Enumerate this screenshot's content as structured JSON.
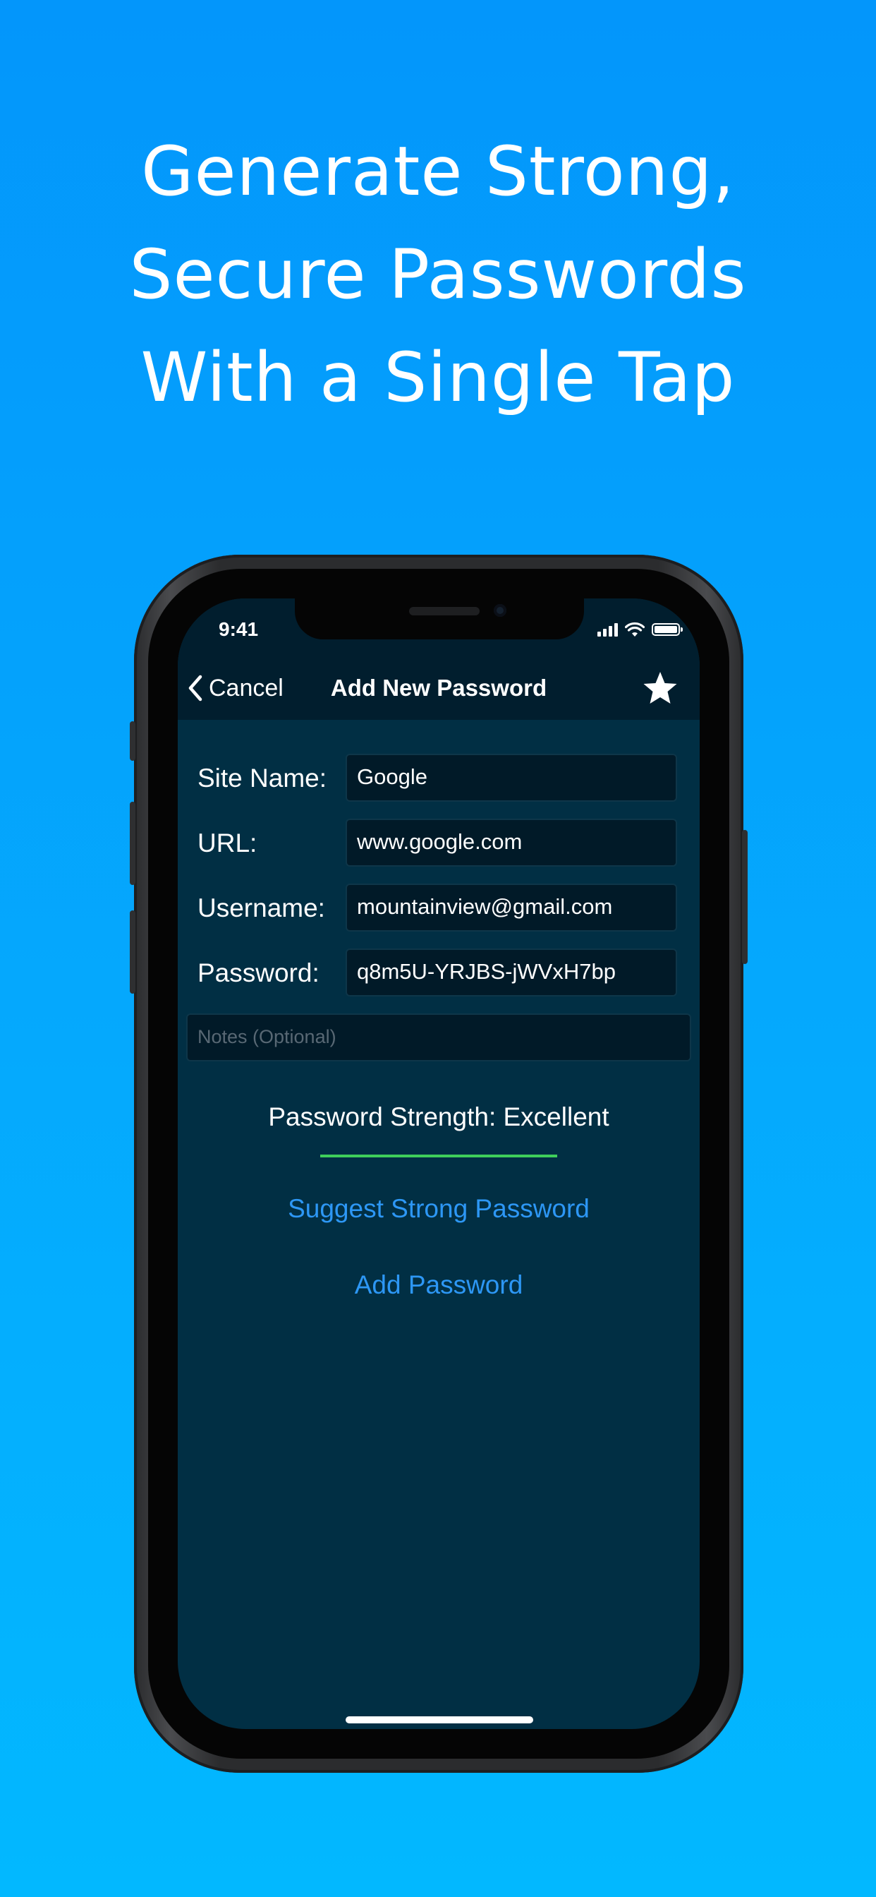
{
  "headline": {
    "line1": "Generate Strong,",
    "line2": "Secure Passwords",
    "line3": "With a Single Tap"
  },
  "status_bar": {
    "time": "9:41",
    "icons": [
      "signal-icon",
      "wifi-icon",
      "battery-icon"
    ]
  },
  "nav": {
    "back_label": "Cancel",
    "title": "Add New Password",
    "favorite_icon": "star-icon"
  },
  "form": {
    "site_name": {
      "label": "Site Name:",
      "value": "Google"
    },
    "url": {
      "label": "URL:",
      "value": "www.google.com"
    },
    "username": {
      "label": "Username:",
      "value": "mountainview@gmail.com"
    },
    "password": {
      "label": "Password:",
      "value": "q8m5U-YRJBS-jWVxH7bp"
    },
    "notes": {
      "placeholder": "Notes (Optional)",
      "value": ""
    }
  },
  "strength": {
    "text": "Password Strength: Excellent",
    "level": 1.0,
    "color": "#3fce5b"
  },
  "actions": {
    "suggest_label": "Suggest Strong Password",
    "add_label": "Add Password"
  },
  "colors": {
    "background_top": "#0396fb",
    "background_bottom": "#02b8ff",
    "screen_bg": "#012f44",
    "navbar_bg": "#011e2e",
    "link": "#2d97f5"
  }
}
